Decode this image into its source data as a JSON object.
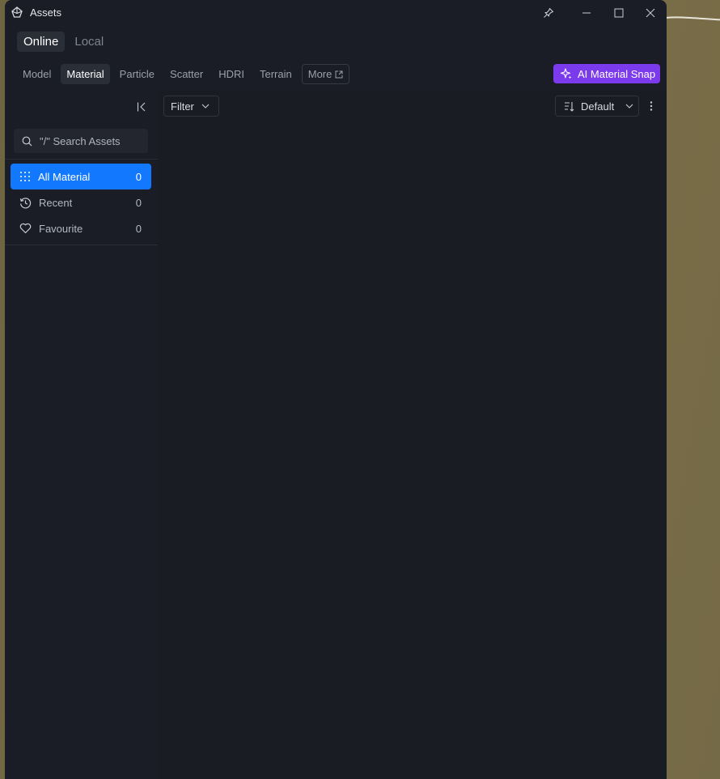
{
  "window": {
    "title": "Assets",
    "icons": {
      "app": "assets-logo-icon",
      "pin": "pin-icon",
      "minimize": "minimize-icon",
      "maximize": "maximize-icon",
      "close": "close-icon"
    }
  },
  "mode_tabs": [
    {
      "label": "Online",
      "active": true
    },
    {
      "label": "Local",
      "active": false
    }
  ],
  "type_tabs": [
    {
      "label": "Model",
      "active": false
    },
    {
      "label": "Material",
      "active": true
    },
    {
      "label": "Particle",
      "active": false
    },
    {
      "label": "Scatter",
      "active": false
    },
    {
      "label": "HDRI",
      "active": false
    },
    {
      "label": "Terrain",
      "active": false
    }
  ],
  "more_tab": {
    "label": "More",
    "icon": "external-link-icon"
  },
  "ai_button": {
    "label": "AI Material Snap",
    "icon": "sparkle-icon",
    "color": "#7c3aed"
  },
  "sidebar": {
    "search_placeholder": "\"/\" Search Assets",
    "items": [
      {
        "label": "All Material",
        "count": "0",
        "icon": "grid-dots-icon",
        "active": true
      },
      {
        "label": "Recent",
        "count": "0",
        "icon": "history-icon",
        "active": false
      },
      {
        "label": "Favourite",
        "count": "0",
        "icon": "heart-icon",
        "active": false
      }
    ]
  },
  "toolbar": {
    "filter_label": "Filter",
    "sort_label": "Default",
    "icons": {
      "sort": "sort-icon",
      "chevron": "chevron-down-icon",
      "more": "more-vertical-icon"
    }
  },
  "colors": {
    "accent": "#1279ff",
    "background": "#1a1d25"
  }
}
